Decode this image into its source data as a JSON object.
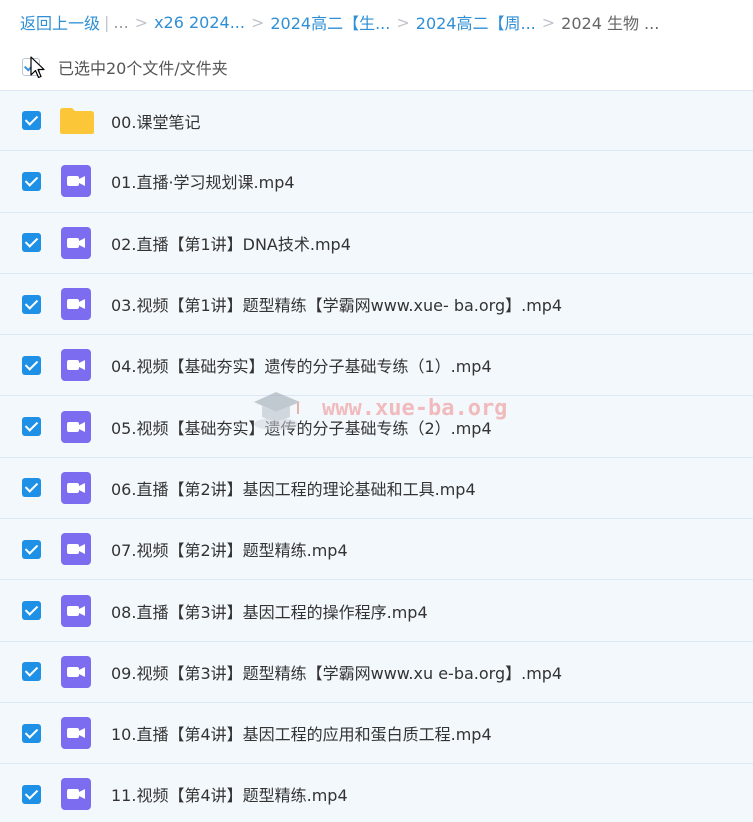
{
  "breadcrumb": {
    "back": "返回上一级",
    "pipe": "|",
    "ellipsis": "...",
    "sep": ">",
    "items": [
      "x26 2024...",
      "2024高二【生...",
      "2024高二【周..."
    ],
    "current": "2024 生物 ..."
  },
  "selection": {
    "label": "已选中20个文件/文件夹"
  },
  "files": [
    {
      "name": "00.课堂笔记",
      "type": "folder"
    },
    {
      "name": "01.直播·学习规划课.mp4",
      "type": "video"
    },
    {
      "name": "02.直播【第1讲】DNA技术.mp4",
      "type": "video"
    },
    {
      "name": "03.视频【第1讲】题型精练【学霸网www.xue- ba.org】.mp4",
      "type": "video"
    },
    {
      "name": "04.视频【基础夯实】遗传的分子基础专练（1）.mp4",
      "type": "video"
    },
    {
      "name": "05.视频【基础夯实】遗传的分子基础专练（2）.mp4",
      "type": "video"
    },
    {
      "name": "06.直播【第2讲】基因工程的理论基础和工具.mp4",
      "type": "video"
    },
    {
      "name": "07.视频【第2讲】题型精练.mp4",
      "type": "video"
    },
    {
      "name": "08.直播【第3讲】基因工程的操作程序.mp4",
      "type": "video"
    },
    {
      "name": "09.视频【第3讲】题型精练【学霸网www.xu e-ba.org】.mp4",
      "type": "video"
    },
    {
      "name": "10.直播【第4讲】基因工程的应用和蛋白质工程.mp4",
      "type": "video"
    },
    {
      "name": "11.视频【第4讲】题型精练.mp4",
      "type": "video"
    }
  ],
  "watermark": {
    "text": "www.xue-ba.org"
  },
  "colors": {
    "link": "#2f8fd6",
    "row_bg": "#f3f8fd",
    "checkbox": "#1e90e6",
    "folder": "#fbc739",
    "video_icon": "#7b6cf0"
  }
}
